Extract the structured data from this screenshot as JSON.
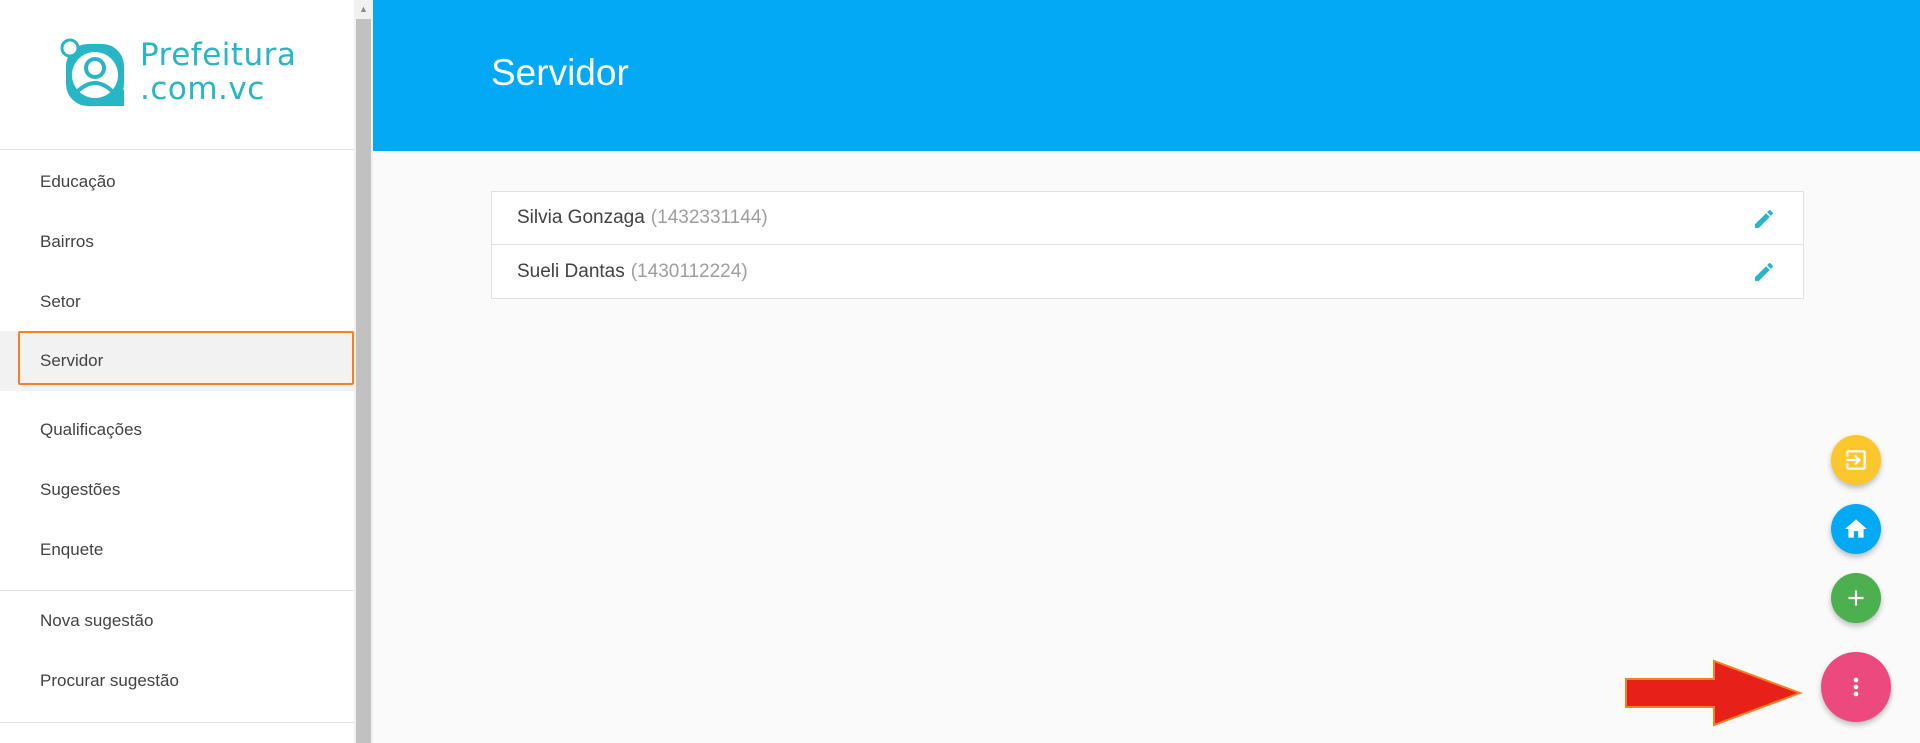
{
  "brand": {
    "line1": "Prefeitura",
    "line2": ".com.vc",
    "color": "#26b6c6"
  },
  "sidebar": {
    "items": [
      {
        "label": "Educação"
      },
      {
        "label": "Bairros"
      },
      {
        "label": "Setor"
      },
      {
        "label": "Servidor",
        "active": true
      },
      {
        "label": "Qualificações"
      },
      {
        "label": "Sugestões"
      },
      {
        "label": "Enquete"
      },
      {
        "label": "Nova sugestão"
      },
      {
        "label": "Procurar sugestão"
      }
    ],
    "active_outline_color": "#f58220"
  },
  "header": {
    "title": "Servidor",
    "background": "#03a9f4"
  },
  "servidores": [
    {
      "name": "Silvia Gonzaga",
      "code": "(1432331144)"
    },
    {
      "name": "Sueli Dantas",
      "code": "(1430112224)"
    }
  ],
  "icons": {
    "row_action": "pencil-icon",
    "fab_exit": "exit-icon",
    "fab_home": "home-icon",
    "fab_add": "plus-icon",
    "fab_menu": "more-vert-icon"
  },
  "colors": {
    "fab_exit": "#fcc72c",
    "fab_home": "#03a9f4",
    "fab_add": "#4caf50",
    "fab_menu": "#ec4a7f",
    "edit_icon": "#26b6c6",
    "annotation_arrow": "#e8201a"
  }
}
